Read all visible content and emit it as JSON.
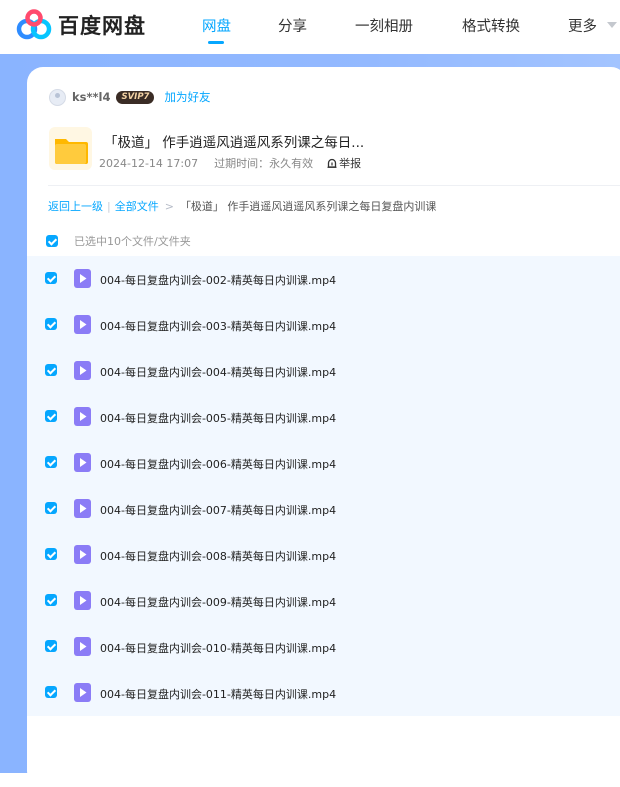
{
  "header": {
    "logo_text": "百度网盘",
    "nav": [
      {
        "label": "网盘",
        "active": true
      },
      {
        "label": "分享",
        "active": false
      },
      {
        "label": "一刻相册",
        "active": false
      },
      {
        "label": "格式转换",
        "active": false
      },
      {
        "label": "更多",
        "active": false
      }
    ]
  },
  "share": {
    "user_name": "ks**l4",
    "badge": "SVIP7",
    "add_friend": "加为好友",
    "title": "「极道」 作手逍遥风逍遥风系列课之每日...",
    "date": "2024-12-14 17:07",
    "expire": "过期时间：永久有效",
    "report": "举报"
  },
  "breadcrumb": {
    "back": "返回上一级",
    "sep": "|",
    "all_files": "全部文件",
    "arrow": ">",
    "current": "「极道」 作手逍遥风逍遥风系列课之每日复盘内训课"
  },
  "selection": {
    "text": "已选中10个文件/文件夹",
    "checked": true
  },
  "files": [
    {
      "name": "004-每日复盘内训会-002-精英每日内训课.mp4",
      "checked": true
    },
    {
      "name": "004-每日复盘内训会-003-精英每日内训课.mp4",
      "checked": true
    },
    {
      "name": "004-每日复盘内训会-004-精英每日内训课.mp4",
      "checked": true
    },
    {
      "name": "004-每日复盘内训会-005-精英每日内训课.mp4",
      "checked": true
    },
    {
      "name": "004-每日复盘内训会-006-精英每日内训课.mp4",
      "checked": true
    },
    {
      "name": "004-每日复盘内训会-007-精英每日内训课.mp4",
      "checked": true
    },
    {
      "name": "004-每日复盘内训会-008-精英每日内训课.mp4",
      "checked": true
    },
    {
      "name": "004-每日复盘内训会-009-精英每日内训课.mp4",
      "checked": true
    },
    {
      "name": "004-每日复盘内训会-010-精英每日内训课.mp4",
      "checked": true
    },
    {
      "name": "004-每日复盘内训会-011-精英每日内训课.mp4",
      "checked": true
    }
  ],
  "icons": {
    "logo": "baidu-netdisk-logo",
    "folder": "folder-icon",
    "video": "video-file-icon",
    "report": "report-icon",
    "more": "chevron-down-icon"
  },
  "colors": {
    "accent": "#06a7ff",
    "background": "#8fb7ff",
    "selected_row": "#f2f8ff",
    "video_icon": "#8b7cf6",
    "folder": "#ffc233"
  }
}
